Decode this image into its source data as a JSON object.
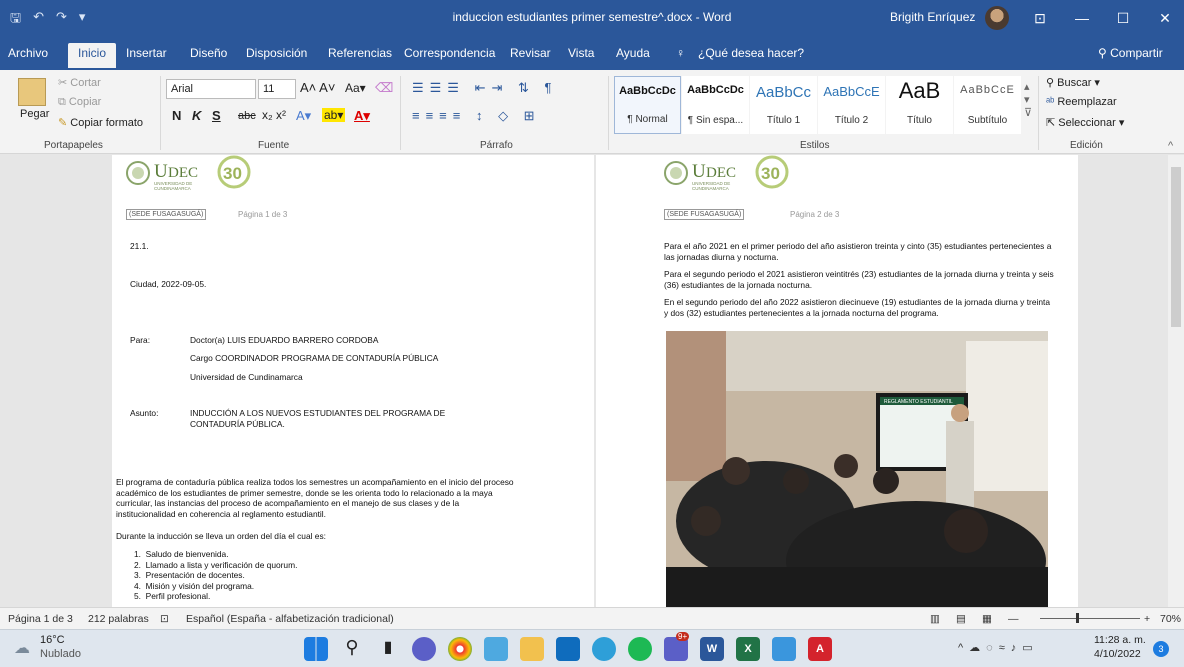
{
  "titlebar": {
    "doc_title": "induccion estudiantes primer semestre^.docx  -  Word",
    "user_name": "Brigith Enríquez",
    "minimize": "—",
    "maximize": "☐",
    "close": "✕"
  },
  "tabs": [
    "Archivo",
    "Inicio",
    "Insertar",
    "Diseño",
    "Disposición",
    "Referencias",
    "Correspondencia",
    "Revisar",
    "Vista",
    "Ayuda"
  ],
  "tell_me": "¿Qué desea hacer?",
  "share": "Compartir",
  "clipboard": {
    "paste": "Pegar",
    "cut": "Cortar",
    "copy": "Copiar",
    "format_painter": "Copiar formato",
    "label": "Portapapeles"
  },
  "font": {
    "name": "Arial",
    "size": "11",
    "label": "Fuente",
    "bold": "N",
    "italic": "K",
    "underline": "S",
    "strike": "abc"
  },
  "paragraph": {
    "label": "Párrafo"
  },
  "styles": {
    "label": "Estilos",
    "items": [
      {
        "sample": "AaBbCcDc",
        "name": "¶ Normal"
      },
      {
        "sample": "AaBbCcDc",
        "name": "¶ Sin espa..."
      },
      {
        "sample": "AaBbCc",
        "name": "Título 1"
      },
      {
        "sample": "AaBbCcE",
        "name": "Título 2"
      },
      {
        "sample": "AaB",
        "name": "Título"
      },
      {
        "sample": "AaBbCcE",
        "name": "Subtítulo"
      }
    ]
  },
  "editing": {
    "label": "Edición",
    "find": "Buscar",
    "replace": "Reemplazar",
    "select": "Seleccionar"
  },
  "page1": {
    "logo_name": "UDEC",
    "logo_sub": "UNIVERSIDAD DE CUNDINAMARCA",
    "logo_num": "30",
    "sede": "(SEDE FUSAGASUGÁ)",
    "pagenum": "Página 1 de 3",
    "code": "21.1.",
    "city_date": "Ciudad, 2022-09-05.",
    "para_label": "Para:",
    "para_line1": "Doctor(a) LUIS EDUARDO BARRERO CORDOBA",
    "para_line2": "Cargo COORDINADOR PROGRAMA DE CONTADURÍA PÚBLICA",
    "para_line3": "Universidad de Cundinamarca",
    "subject_label": "Asunto:",
    "subject": "INDUCCIÓN A LOS NUEVOS ESTUDIANTES DEL PROGRAMA DE CONTADURÍA PÚBLICA.",
    "body1": "El programa de contaduría pública realiza todos los semestres un acompañamiento en el inicio del proceso académico de los estudiantes de primer semestre, donde se les orienta todo lo relacionado a la maya curricular, las instancias del proceso de acompañamiento en el manejo de sus clases y de la institucionalidad en coherencia al reglamento estudiantil.",
    "body2": "Durante la inducción se lleva un orden del día el cual es:",
    "list": [
      "Saludo de bienvenida.",
      "Llamado a lista y verificación de quorum.",
      "Presentación de docentes.",
      "Misión y visión del programa.",
      "Perfil profesional."
    ]
  },
  "page2": {
    "logo_name": "UDEC",
    "logo_sub": "UNIVERSIDAD DE CUNDINAMARCA",
    "logo_num": "30",
    "sede": "(SEDE FUSAGASUGÁ)",
    "pagenum": "Página 2 de 3",
    "p1": "Para el año 2021 en el primer periodo del año asistieron treinta y cinto (35) estudiantes pertenecientes a las jornadas diurna y nocturna.",
    "p2": "Para el segundo periodo el 2021 asistieron veintitrés (23) estudiantes de la jornada diurna y treinta y seis (36) estudiantes de la jornada nocturna.",
    "p3": "En el segundo periodo del año 2022 asistieron diecinueve (19) estudiantes de la jornada diurna y treinta y dos (32) estudiantes pertenecientes a la jornada nocturna del programa.",
    "photo_screen_title": "REGLAMENTO ESTUDIANTIL"
  },
  "statusbar": {
    "page": "Página 1 de 3",
    "words": "212 palabras",
    "language": "Español (España - alfabetización tradicional)",
    "zoom": "70%"
  },
  "taskbar": {
    "temp": "16°C",
    "weather": "Nublado",
    "time": "11:28 a. m.",
    "date": "4/10/2022",
    "notif_count": "3",
    "teams_badge": "9+"
  },
  "colors": {
    "word_blue": "#2b579a",
    "ribbon_bg": "#f3f3f3",
    "doc_bg": "#e6e6e6"
  }
}
